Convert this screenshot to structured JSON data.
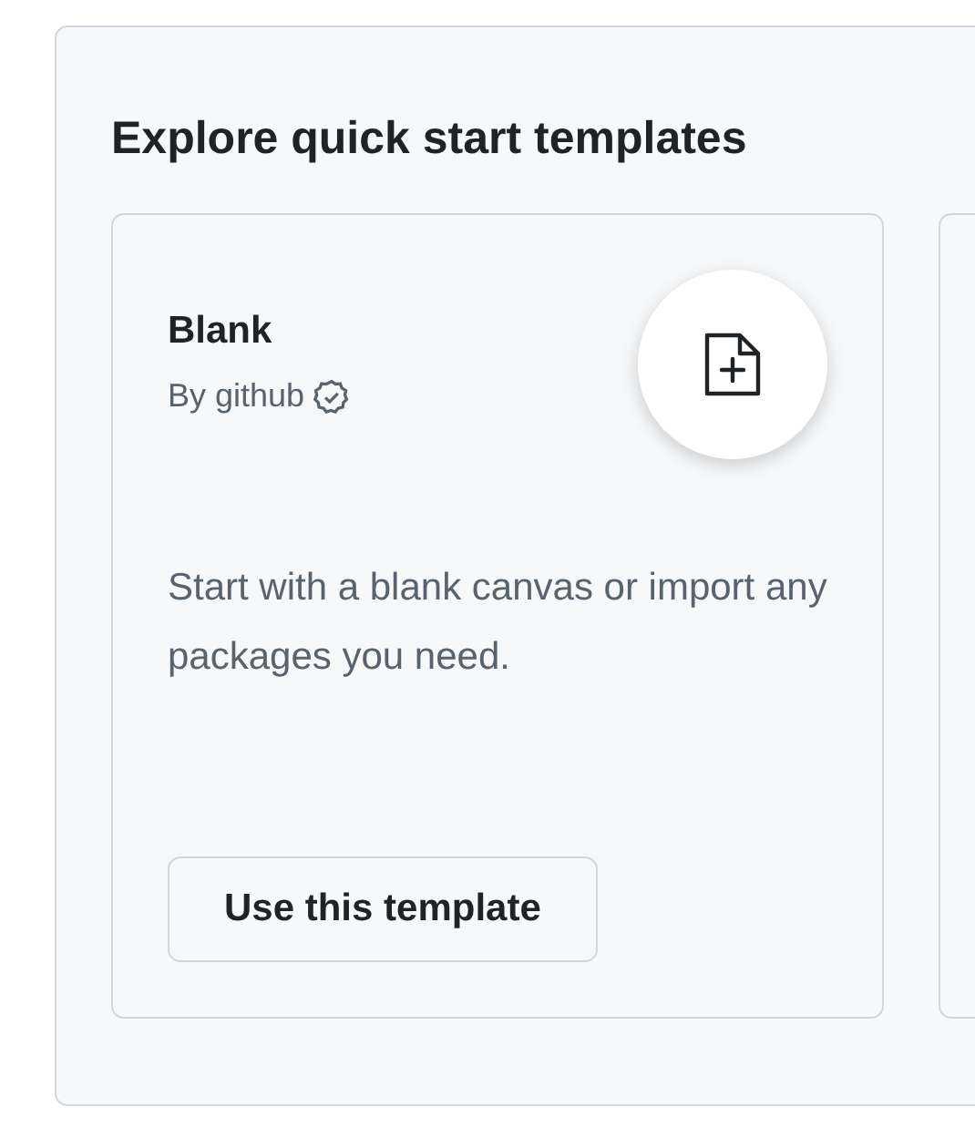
{
  "section": {
    "title": "Explore quick start templates"
  },
  "templates": [
    {
      "name": "Blank",
      "author": "By github",
      "verified": true,
      "description": "Start with a blank canvas or import any packages you need.",
      "button": "Use this template"
    }
  ]
}
